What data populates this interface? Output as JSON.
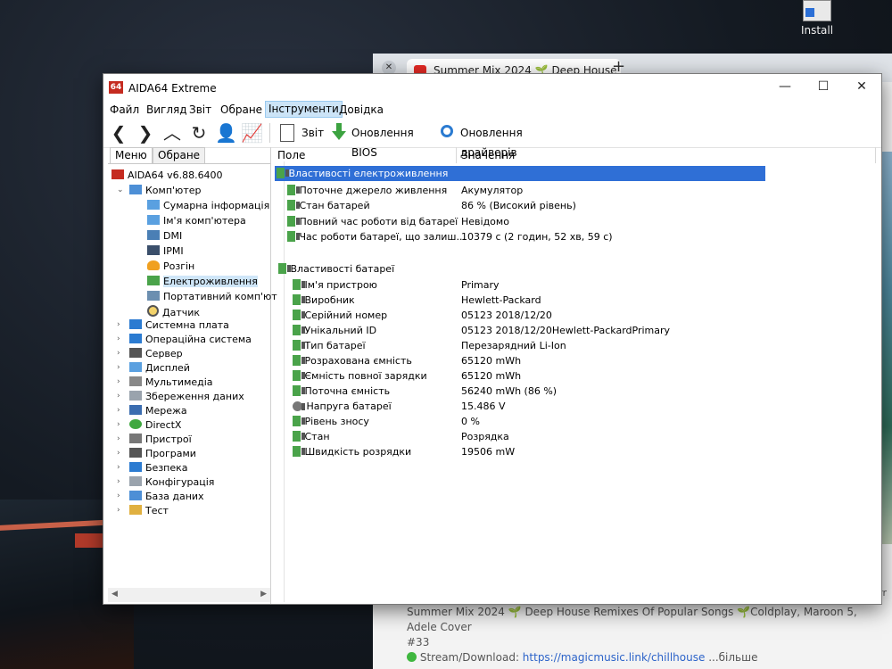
{
  "desktop": {
    "install_label": "Install"
  },
  "browser": {
    "tab_title": "Summer Mix 2024 🌱 Deep House",
    "tab_close": "✕",
    "new_tab": "+",
    "side_text": "ummerr",
    "desc_line1": "Summer Mix 2024 🌱 Deep House Remixes Of Popular Songs 🌱Coldplay, Maroon 5, Adele Cover",
    "desc_line2": "#33",
    "desc_stream": "Stream/Download: ",
    "desc_link": "https://magicmusic.link/chillhouse",
    "desc_more": "...більше"
  },
  "window": {
    "title": "AIDA64 Extreme",
    "app_icon": "64",
    "min": "—",
    "max": "☐",
    "close": "✕"
  },
  "menu": [
    "Файл",
    "Вигляд",
    "Звіт",
    "Обране",
    "Інструменти",
    "Довідка"
  ],
  "toolbar": {
    "report": "Звіт",
    "bios_update": "Оновлення BIOS",
    "driver_update": "Оновлення драйверів"
  },
  "left_tabs": [
    "Меню",
    "Обране"
  ],
  "tree": [
    {
      "label": "AIDA64 v6.88.6400"
    },
    {
      "label": "Комп'ютер"
    },
    {
      "label": "Сумарна інформація"
    },
    {
      "label": "Ім'я комп'ютера"
    },
    {
      "label": "DMI"
    },
    {
      "label": "IPMI"
    },
    {
      "label": "Розгін"
    },
    {
      "label": "Електроживлення"
    },
    {
      "label": "Портативний комп'ют"
    },
    {
      "label": "Датчик"
    },
    {
      "label": "Системна плата"
    },
    {
      "label": "Операційна система"
    },
    {
      "label": "Сервер"
    },
    {
      "label": "Дисплей"
    },
    {
      "label": "Мультимедіа"
    },
    {
      "label": "Збереження даних"
    },
    {
      "label": "Мережа"
    },
    {
      "label": "DirectX"
    },
    {
      "label": "Пристрої"
    },
    {
      "label": "Програми"
    },
    {
      "label": "Безпека"
    },
    {
      "label": "Конфігурація"
    },
    {
      "label": "База даних"
    },
    {
      "label": "Тест"
    }
  ],
  "columns": {
    "field": "Поле",
    "value": "Значення"
  },
  "sections": {
    "power": "Властивості електроживлення",
    "battery": "Властивості батареї"
  },
  "power_rows": [
    {
      "field": "Поточне джерело живлення",
      "value": "Акумулятор"
    },
    {
      "field": "Стан батарей",
      "value": "86 % (Високий рівень)"
    },
    {
      "field": "Повний час роботи від батареї",
      "value": "Невідомо"
    },
    {
      "field": "Час роботи батареї, що залиш...",
      "value": "10379 с (2 годин, 52 хв, 59 с)"
    }
  ],
  "battery_rows": [
    {
      "field": "Ім'я пристрою",
      "value": "Primary"
    },
    {
      "field": "Виробник",
      "value": "Hewlett-Packard"
    },
    {
      "field": "Серійний номер",
      "value": "05123 2018/12/20"
    },
    {
      "field": "Унікальний ID",
      "value": "05123 2018/12/20Hewlett-PackardPrimary"
    },
    {
      "field": "Тип батареї",
      "value": "Перезарядний Li-Ion"
    },
    {
      "field": "Розрахована ємність",
      "value": "65120 mWh"
    },
    {
      "field": "Ємність повної зарядки",
      "value": "65120 mWh"
    },
    {
      "field": "Поточна ємність",
      "value": "56240 mWh  (86 %)"
    },
    {
      "field": "Напруга батареї",
      "value": "15.486 V"
    },
    {
      "field": "Рівень зносу",
      "value": "0 %"
    },
    {
      "field": "Стан",
      "value": "Розрядка"
    },
    {
      "field": "Швидкість розрядки",
      "value": "19506 mW"
    }
  ]
}
